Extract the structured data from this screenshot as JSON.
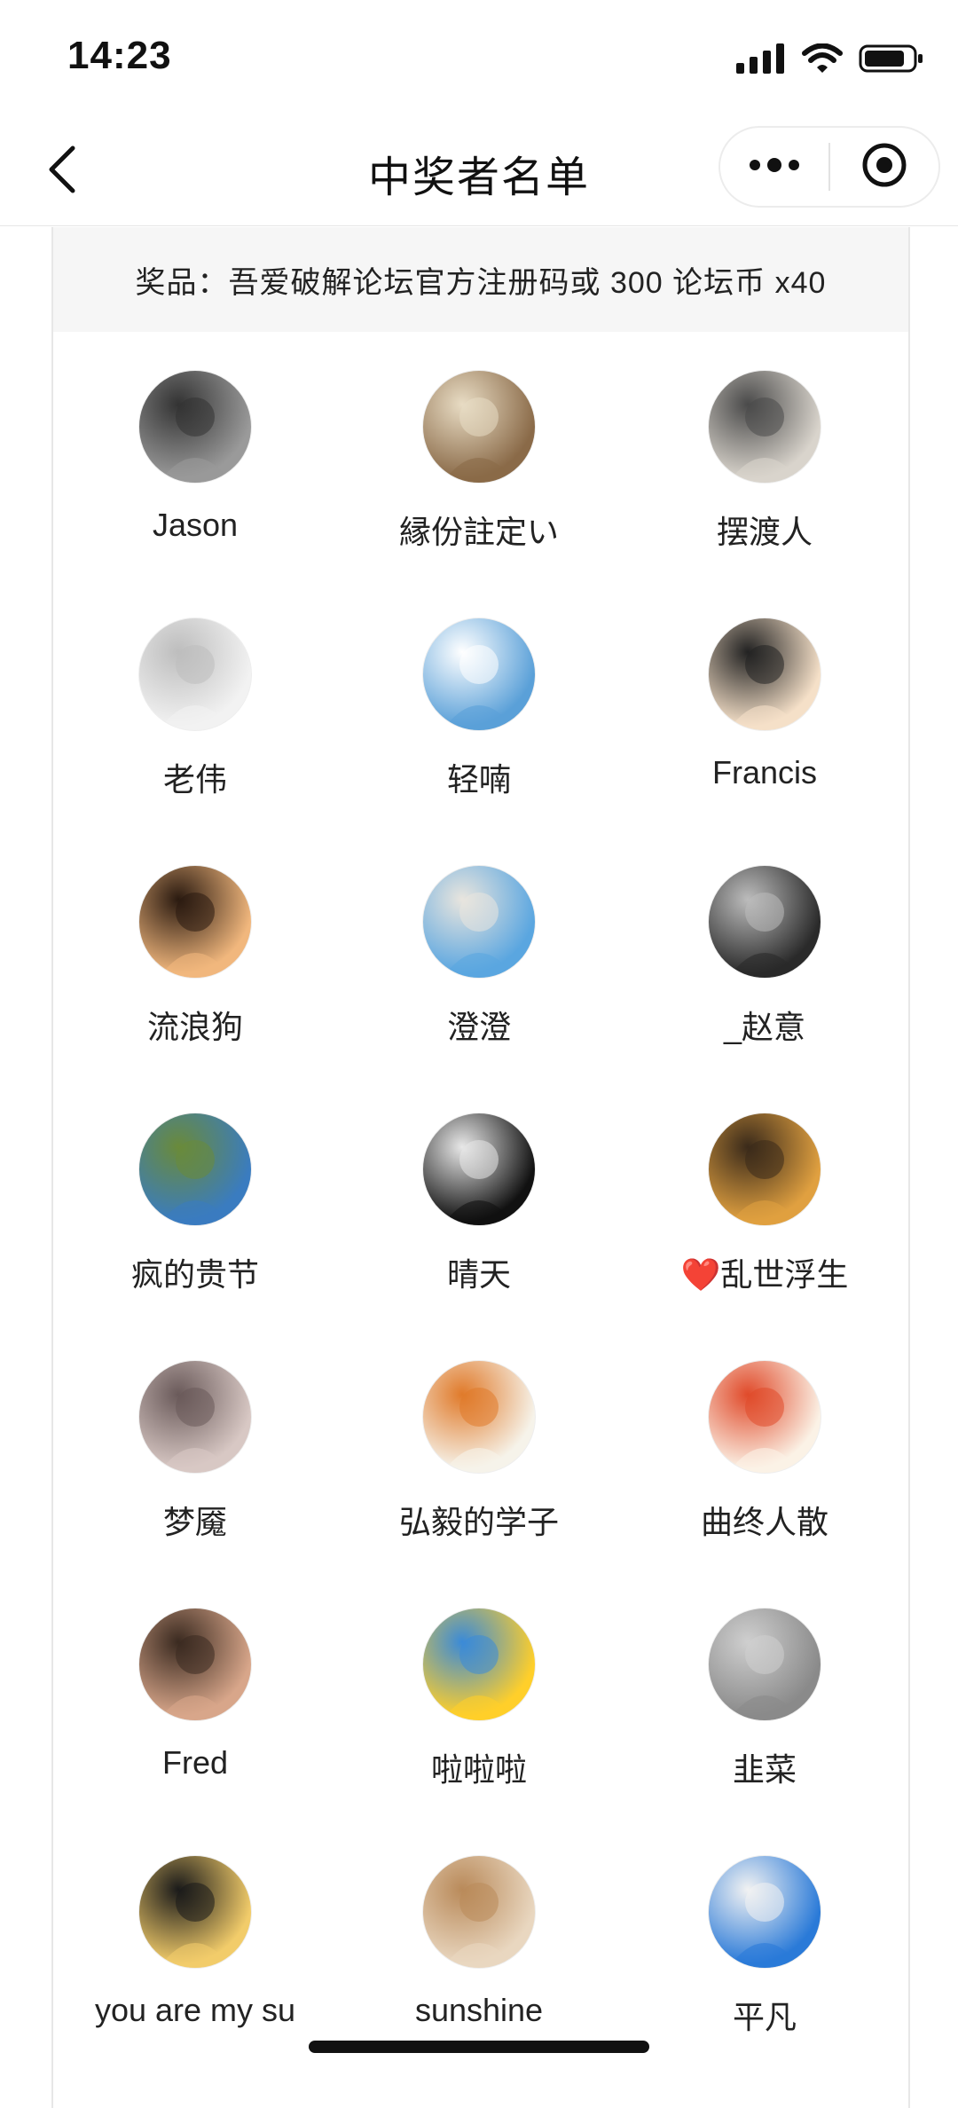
{
  "status_bar": {
    "time": "14:23"
  },
  "nav": {
    "title": "中奖者名单"
  },
  "prize": {
    "text": "奖品：吾爱破解论坛官方注册码或 300 论坛币 x40"
  },
  "winners": [
    {
      "name": "Jason",
      "avatar": "moon-silhouette",
      "colors": [
        "#9a9a9a",
        "#333333"
      ]
    },
    {
      "name": "縁份註定い",
      "avatar": "love-card",
      "colors": [
        "#8a6a48",
        "#e8dcc4"
      ]
    },
    {
      "name": "摆渡人",
      "avatar": "sketch-man",
      "colors": [
        "#d9d4cc",
        "#4a4a4a"
      ]
    },
    {
      "name": "老伟",
      "avatar": "pencil-sketch",
      "colors": [
        "#f2f2f2",
        "#bdbdbd"
      ]
    },
    {
      "name": "轻喃",
      "avatar": "doraemon-cat",
      "colors": [
        "#5aa0d8",
        "#ffffff"
      ]
    },
    {
      "name": "Francis",
      "avatar": "glasses-boy",
      "colors": [
        "#f5e0c8",
        "#222222"
      ]
    },
    {
      "name": "流浪狗",
      "avatar": "laughing-pirate",
      "colors": [
        "#f1b77d",
        "#2a1a10"
      ]
    },
    {
      "name": "澄澄",
      "avatar": "beach-sky",
      "colors": [
        "#5aa6e0",
        "#e9e5de"
      ]
    },
    {
      "name": "_赵意",
      "avatar": "dark-room",
      "colors": [
        "#2a2a2a",
        "#bcbcbc"
      ]
    },
    {
      "name": "疯的贵节",
      "avatar": "windmill",
      "colors": [
        "#3a7cc0",
        "#6a8a3a"
      ]
    },
    {
      "name": "晴天",
      "avatar": "foggy-bench",
      "colors": [
        "#111111",
        "#e8e8e8"
      ]
    },
    {
      "name": "❤️乱世浮生",
      "avatar": "sunset-person",
      "colors": [
        "#e0a040",
        "#3a2a1a"
      ]
    },
    {
      "name": "梦魇",
      "avatar": "couple",
      "colors": [
        "#d8c8c4",
        "#6a5a5a"
      ]
    },
    {
      "name": "弘毅的学子",
      "avatar": "carrot-illustration",
      "colors": [
        "#f6f3ea",
        "#e07a2a"
      ]
    },
    {
      "name": "曲终人散",
      "avatar": "cartoon-boy",
      "colors": [
        "#fbf2e6",
        "#e04a2a"
      ]
    },
    {
      "name": "Fred",
      "avatar": "man-portrait",
      "colors": [
        "#d8a68a",
        "#3a2a20"
      ]
    },
    {
      "name": "啦啦啦",
      "avatar": "yellow-emoji",
      "colors": [
        "#ffcf2a",
        "#3a8ad8"
      ]
    },
    {
      "name": "韭菜",
      "avatar": "plaza-photo",
      "colors": [
        "#8a8a8a",
        "#cfcfcf"
      ]
    },
    {
      "name": "you are my su",
      "avatar": "couple-silhouette",
      "colors": [
        "#f2cc6a",
        "#1a1a1a"
      ]
    },
    {
      "name": "sunshine",
      "avatar": "baby-hat",
      "colors": [
        "#e9d7c0",
        "#b98a5a"
      ]
    },
    {
      "name": "平凡",
      "avatar": "opera-house",
      "colors": [
        "#2a7ad8",
        "#f2f2f2"
      ]
    }
  ]
}
